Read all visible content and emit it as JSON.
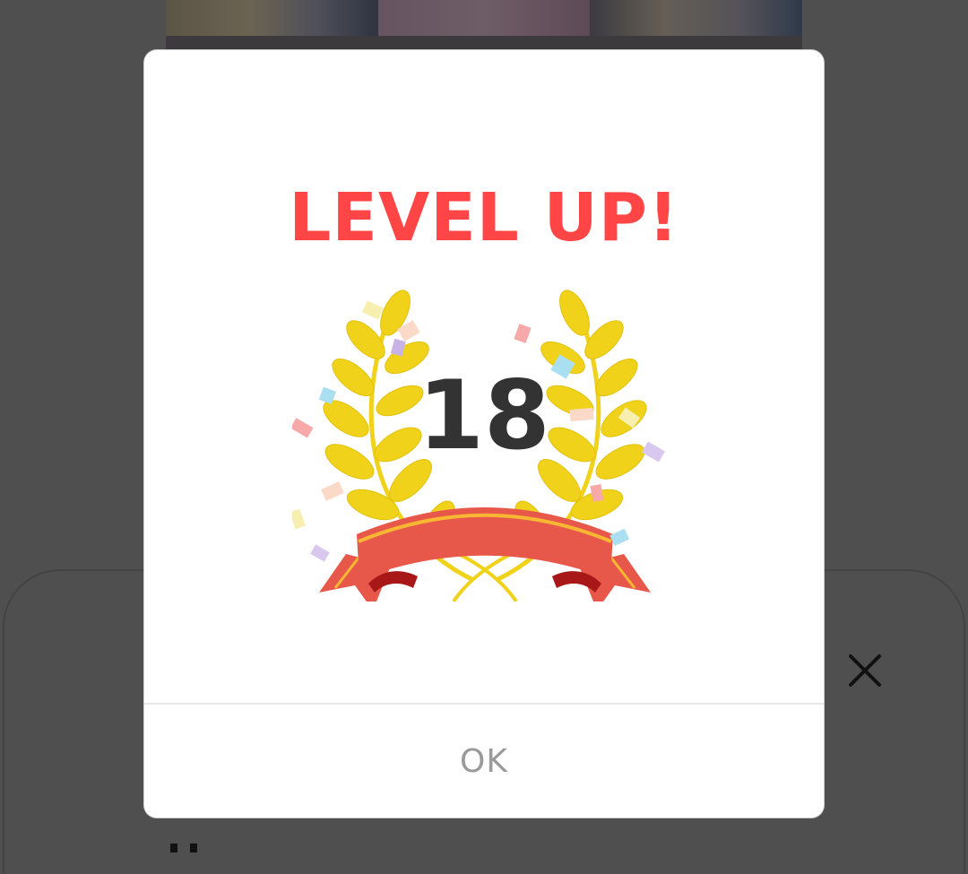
{
  "dialog": {
    "title": "LEVEL UP!",
    "level": "18",
    "ok_label": "OK"
  },
  "colors": {
    "title": "#ff4545",
    "level_number": "#333333",
    "wreath_leaf": "#f0d21a",
    "ribbon": "#e8584a",
    "ribbon_stripe": "#f7b733",
    "overlay": "#4f4f4f",
    "ok_text": "#9a9a9a"
  },
  "icons": {
    "background_close": "close-icon",
    "decoration": "laurel-wreath-icon"
  }
}
